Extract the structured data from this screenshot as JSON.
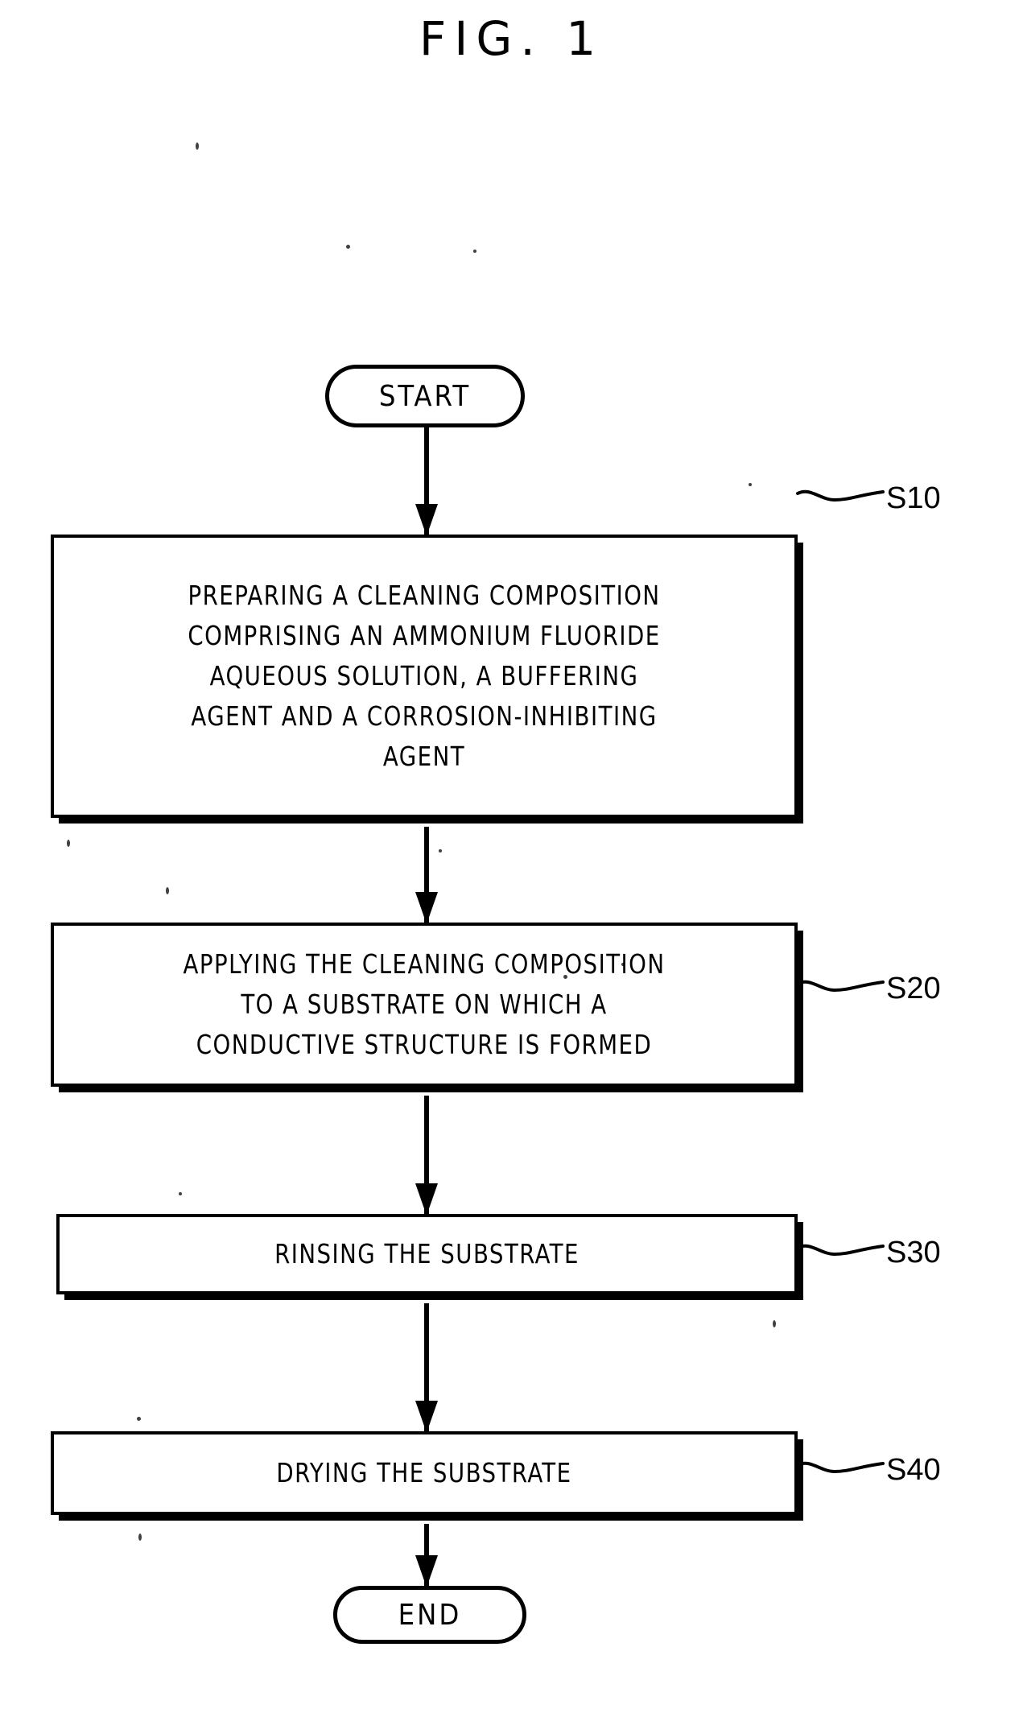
{
  "figure": {
    "title": "FIG. 1",
    "type": "process-flowchart"
  },
  "flowchart": {
    "start_label": "START",
    "end_label": "END",
    "steps": [
      {
        "ref": "S10",
        "shape": "process",
        "text": "PREPARING A CLEANING COMPOSITION\nCOMPRISING AN AMMONIUM FLUORIDE\nAQUEOUS SOLUTION, A BUFFERING\nAGENT AND A CORROSION-INHIBITING\nAGENT"
      },
      {
        "ref": "S20",
        "shape": "process",
        "text": "APPLYING THE CLEANING COMPOSITION\nTO A SUBSTRATE ON WHICH A\nCONDUCTIVE STRUCTURE IS FORMED"
      },
      {
        "ref": "S30",
        "shape": "process",
        "text": "RINSING THE SUBSTRATE"
      },
      {
        "ref": "S40",
        "shape": "process",
        "text": "DRYING THE SUBSTRATE"
      }
    ],
    "connectors": [
      {
        "from": "START",
        "to": "S10",
        "marker": "arrow-down"
      },
      {
        "from": "S10",
        "to": "S20",
        "marker": "arrow-down"
      },
      {
        "from": "S20",
        "to": "S30",
        "marker": "arrow-down"
      },
      {
        "from": "S30",
        "to": "S40",
        "marker": "arrow-down"
      },
      {
        "from": "S40",
        "to": "END",
        "marker": "arrow-down"
      }
    ]
  },
  "colors": {
    "ink": "#000000",
    "paper": "#ffffff"
  }
}
